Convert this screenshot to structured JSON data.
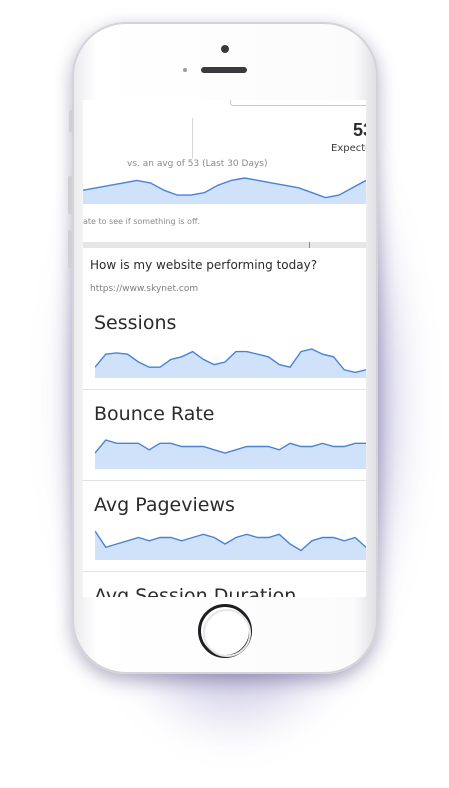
{
  "summary": {
    "big_value": "53",
    "expected_label": "Expected",
    "avg_text": "vs. an avg of 53 (Last 30 Days)",
    "hint_text": "ate to see if something is off."
  },
  "site": {
    "question": "How is my website performing today?",
    "url": "https://www.skynet.com"
  },
  "cards": [
    {
      "title": "Sessions",
      "values": [
        3,
        8,
        8.5,
        8,
        5,
        3,
        3,
        6,
        7,
        9,
        6,
        4,
        5,
        9,
        9,
        8,
        7,
        4,
        3,
        9,
        10,
        8,
        7,
        2,
        1,
        2
      ]
    },
    {
      "title": "Bounce Rate",
      "values": [
        4,
        8,
        7,
        7,
        7,
        5,
        7,
        7,
        6,
        6,
        6,
        5,
        4,
        5,
        6,
        6,
        6,
        5,
        7,
        6,
        6,
        7,
        6,
        6,
        7,
        7
      ]
    },
    {
      "title": "Avg Pageviews",
      "values": [
        8,
        3,
        4,
        5,
        6,
        5,
        6,
        6,
        5,
        6,
        7,
        6,
        4,
        6,
        7,
        6,
        6,
        7,
        4,
        2,
        5,
        6,
        6,
        5,
        6,
        3
      ]
    },
    {
      "title": "Avg Session Duration",
      "values": []
    }
  ],
  "top_series": [
    4,
    5,
    6,
    7,
    8,
    7,
    4,
    2,
    2,
    3,
    6,
    8,
    9,
    8,
    7,
    6,
    5,
    3,
    1,
    2,
    5,
    8
  ],
  "colors": {
    "line": "#4a83d4",
    "fill": "#cfe2f9",
    "glow": "#4f46a0"
  },
  "icons": [
    "camera-icon",
    "speaker-icon",
    "home-button-icon"
  ]
}
